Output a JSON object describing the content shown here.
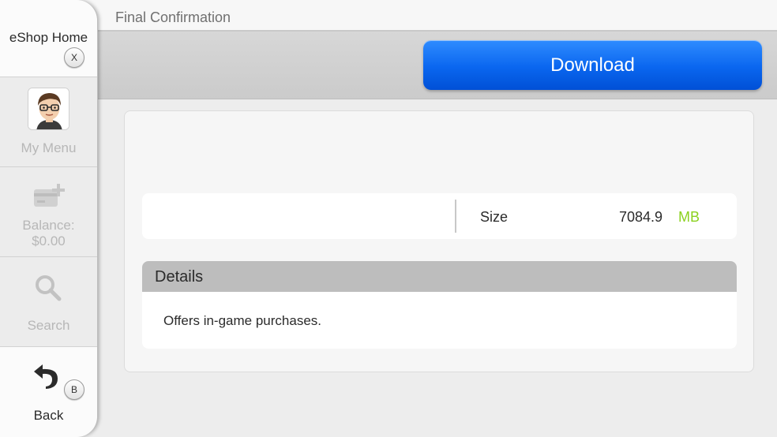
{
  "window": {
    "title": "Final Confirmation"
  },
  "actions": {
    "download_label": "Download"
  },
  "sidebar": {
    "home": {
      "label": "eShop Home",
      "button_hint": "X"
    },
    "my_menu": {
      "label": "My Menu"
    },
    "balance": {
      "label_line1": "Balance:",
      "label_line2": "$0.00"
    },
    "search": {
      "label": "Search"
    },
    "back": {
      "label": "Back",
      "button_hint": "B"
    }
  },
  "info": {
    "size_label": "Size",
    "size_value": "7084.9",
    "size_unit": "MB"
  },
  "details": {
    "title": "Details",
    "text": "Offers in-game purchases."
  },
  "colors": {
    "accent_blue": "#0a66ef",
    "unit_green": "#8bd11f",
    "disabled_text": "#b7b7b7"
  },
  "icons": {
    "home": "close-x-button-icon",
    "avatar": "mii-avatar-icon",
    "balance": "card-plus-icon",
    "search": "magnifier-icon",
    "back": "back-arrow-icon"
  }
}
